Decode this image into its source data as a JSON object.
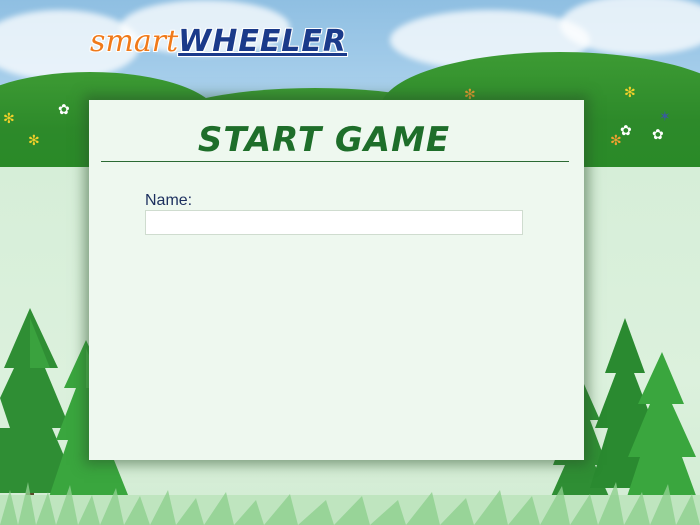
{
  "app": {
    "logo_smart": "smart",
    "logo_wheeler": "WHEELER"
  },
  "colors": {
    "logo_smart": "#f07a1a",
    "logo_wheeler": "#1a3a8a",
    "title": "#1e6e2a",
    "panel_bg": "#eef8ef",
    "grass": "#2f8f2c"
  },
  "dialog": {
    "title": "START GAME",
    "name_label": "Name:",
    "name_value": "",
    "name_placeholder": ""
  },
  "icons": [
    "flower-icon",
    "tree-icon",
    "cloud-icon"
  ]
}
